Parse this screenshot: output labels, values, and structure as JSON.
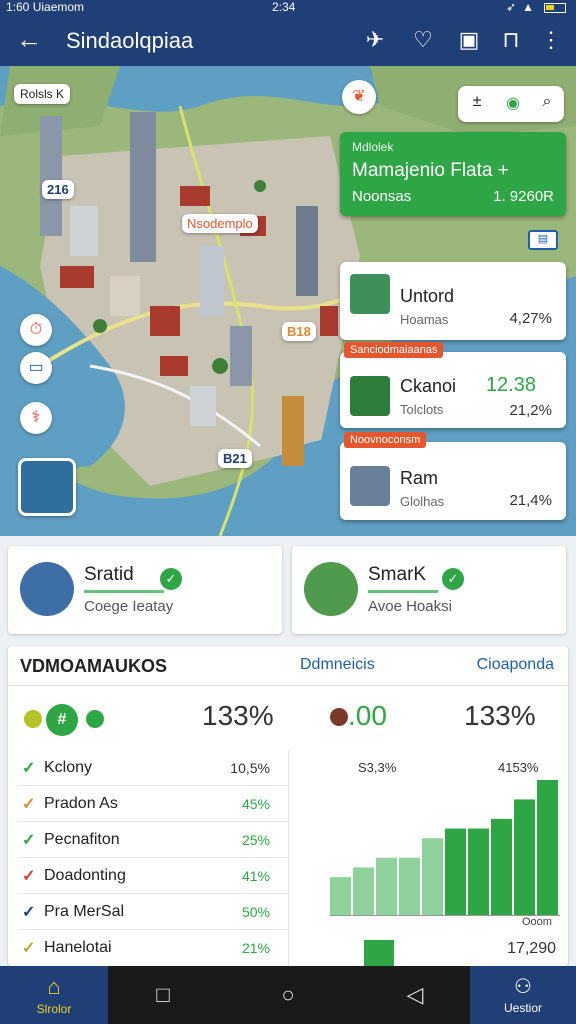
{
  "status_bar": {
    "left": "1:60 Uiaemom",
    "time": "2:34"
  },
  "app_bar": {
    "title": "Sindaolqpiaa"
  },
  "map": {
    "top_left_chip": "Rolsls K",
    "label_pin_1": "216",
    "label_pin_2": "Nsodemplo",
    "label_pin_3": "B21",
    "label_pin_4": "B18",
    "green_card": {
      "label": "Mdlolek",
      "title": "Mamajenio Flata +",
      "subtitle": "Noonsas",
      "value": "1. 9260R"
    },
    "poi_cards": [
      {
        "name": "Untord",
        "sub": "Hoamas",
        "value": "4,27%"
      },
      {
        "tag": "Sanciodmaiaanas",
        "name": "Ckanoi",
        "sub": "Tolclots",
        "big": "12.38",
        "value": "21,2%"
      },
      {
        "tag": "Noovnoconsm",
        "name": "Ram",
        "sub": "Glolhas",
        "value": "21,4%"
      }
    ]
  },
  "place_cards": [
    {
      "name": "Sratid",
      "sub": "Coege  Ieatay"
    },
    {
      "name": "SmarK",
      "sub": "Avoe Hoaksi"
    }
  ],
  "stats": {
    "title": "VDMOAMAUKOS",
    "links": [
      "Ddmneicis",
      "Cioaponda"
    ],
    "kpis": [
      "133%",
      ".00",
      "133%"
    ],
    "rows": [
      {
        "label": "Kclony",
        "value": "10,5%",
        "check_color": "#2ea646"
      },
      {
        "label": "Pradon As",
        "value": "45%",
        "check_color": "#e4872e"
      },
      {
        "label": "Pecnafiton",
        "value": "25%",
        "check_color": "#2ea646"
      },
      {
        "label": "Doadonting",
        "value": "41%",
        "check_color": "#d9393a"
      },
      {
        "label": "Pra MerSal",
        "value": "50%",
        "check_color": "#1f3f76"
      },
      {
        "label": "Hanelotai",
        "value": "21%",
        "check_color": "#b5a82a"
      }
    ],
    "col_heads": [
      "S3,3%",
      "4153%"
    ],
    "chart_foot": "Ooom",
    "total": "17,290"
  },
  "chart_data": {
    "type": "bar",
    "values": [
      4,
      5,
      6,
      6,
      8,
      9,
      9,
      10,
      12,
      14
    ],
    "ylim": [
      0,
      14
    ]
  },
  "nav": {
    "home_label": "Slrolor",
    "user_label": "Uestior"
  },
  "colors": {
    "brand": "#1f3f76",
    "accent": "#2ea646",
    "tag": "#e4572e"
  }
}
